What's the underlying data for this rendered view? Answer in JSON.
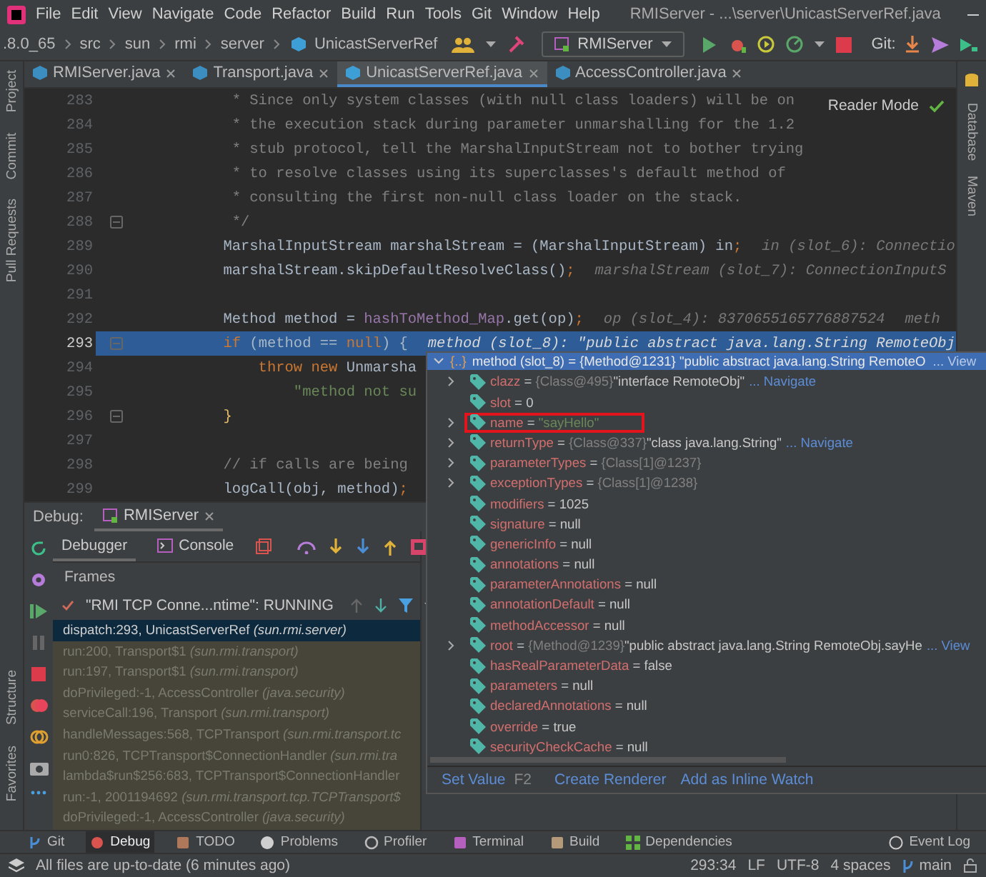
{
  "window": {
    "title": "RMIServer - ...\\server\\UnicastServerRef.java"
  },
  "menu": [
    "File",
    "Edit",
    "View",
    "Navigate",
    "Code",
    "Refactor",
    "Build",
    "Run",
    "Tools",
    "Git",
    "Window",
    "Help"
  ],
  "breadcrumbs": [
    ".8.0_65",
    "src",
    "sun",
    "rmi",
    "server",
    "UnicastServerRef"
  ],
  "run_config": "RMIServer",
  "git_label": "Git:",
  "tabs": [
    {
      "label": "RMIServer.java",
      "selected": false
    },
    {
      "label": "Transport.java",
      "selected": false
    },
    {
      "label": "UnicastServerRef.java",
      "selected": true
    },
    {
      "label": "AccessController.java",
      "selected": false
    }
  ],
  "left_tools_top": [
    "Project",
    "Commit",
    "Pull Requests"
  ],
  "left_tools_bottom": [
    "Structure",
    "Favorites"
  ],
  "right_tools": [
    "Database",
    "Maven"
  ],
  "editor": {
    "reader_mode": "Reader Mode",
    "lines": [
      {
        "number": "283",
        "current": false,
        "fold": false,
        "tokens": [
          {
            "text": "         * Since only system classes (with null class loaders) will be on",
            "kind": "comment"
          }
        ]
      },
      {
        "number": "284",
        "current": false,
        "fold": false,
        "tokens": [
          {
            "text": "         * the execution stack during parameter unmarshalling for the 1.2",
            "kind": "comment"
          }
        ]
      },
      {
        "number": "285",
        "current": false,
        "fold": false,
        "tokens": [
          {
            "text": "         * stub protocol, tell the MarshalInputStream not to bother trying",
            "kind": "comment"
          }
        ]
      },
      {
        "number": "286",
        "current": false,
        "fold": false,
        "tokens": [
          {
            "text": "         * to resolve classes using its superclasses's default method of",
            "kind": "comment"
          }
        ]
      },
      {
        "number": "287",
        "current": false,
        "fold": false,
        "tokens": [
          {
            "text": "         * consulting the first non-null class loader on the stack.",
            "kind": "comment"
          }
        ]
      },
      {
        "number": "288",
        "current": false,
        "fold": true,
        "tokens": [
          {
            "text": "         */",
            "kind": "comment"
          }
        ]
      },
      {
        "number": "289",
        "current": false,
        "fold": false,
        "tokens": [
          {
            "text": "        MarshalInputStream marshalStream = (MarshalInputStream) in",
            "kind": "plain"
          },
          {
            "text": ";",
            "kind": "keyword"
          }
        ],
        "hints": [
          "in (slot_6): Connectio"
        ]
      },
      {
        "number": "290",
        "current": false,
        "fold": false,
        "tokens": [
          {
            "text": "        marshalStream.skipDefaultResolveClass()",
            "kind": "plain"
          },
          {
            "text": ";",
            "kind": "keyword"
          }
        ],
        "hints": [
          "marshalStream (slot_7): ConnectionInputS"
        ]
      },
      {
        "number": "291",
        "current": false,
        "fold": false
      },
      {
        "number": "292",
        "current": false,
        "fold": false,
        "tokens": [
          {
            "text": "        Method method = ",
            "kind": "plain"
          },
          {
            "text": "hashToMethod_Map",
            "kind": "field"
          },
          {
            "text": ".get(op)",
            "kind": "plain"
          },
          {
            "text": ";",
            "kind": "keyword"
          }
        ],
        "hints": [
          "op (slot_4): 8370655165776887524",
          "meth"
        ]
      },
      {
        "number": "293",
        "current": true,
        "fold": true,
        "tokens": [
          {
            "text": "        if",
            "kind": "keyword"
          },
          {
            "text": " (method == ",
            "kind": "plain"
          },
          {
            "text": "null",
            "kind": "keyword"
          },
          {
            "text": ") {",
            "kind": "plain"
          }
        ],
        "hints": [
          "method (slot_8): \"public abstract java.lang.String RemoteObj"
        ]
      },
      {
        "number": "294",
        "current": false,
        "fold": false,
        "tokens": [
          {
            "text": "            throw new",
            "kind": "keyword"
          },
          {
            "text": " Unmarsha",
            "kind": "plain"
          }
        ]
      },
      {
        "number": "295",
        "current": false,
        "fold": false,
        "tokens": [
          {
            "text": "                \"method not su",
            "kind": "string"
          }
        ]
      },
      {
        "number": "296",
        "current": false,
        "fold": true,
        "tokens": [
          {
            "text": "        }",
            "kind": "brace"
          }
        ]
      },
      {
        "number": "297",
        "current": false,
        "fold": false
      },
      {
        "number": "298",
        "current": false,
        "fold": false,
        "tokens": [
          {
            "text": "        // if calls are being ",
            "kind": "comment"
          }
        ]
      },
      {
        "number": "299",
        "current": false,
        "fold": false,
        "tokens": [
          {
            "text": "        logCall(obj, method)",
            "kind": "plain"
          },
          {
            "text": ";",
            "kind": "keyword"
          }
        ]
      }
    ]
  },
  "debug": {
    "label": "Debug:",
    "session": "RMIServer",
    "tabs": [
      {
        "label": "Debugger",
        "selected": true
      },
      {
        "label": "Console",
        "selected": false
      }
    ],
    "frames_label": "Frames",
    "thread": "\"RMI TCP Conne...ntime\": RUNNING",
    "frames": [
      {
        "location": "dispatch:293, UnicastServerRef",
        "package": "(sun.rmi.server)",
        "selected": true
      },
      {
        "location": "run:200, Transport$1",
        "package": "(sun.rmi.transport)",
        "selected": false
      },
      {
        "location": "run:197, Transport$1",
        "package": "(sun.rmi.transport)",
        "selected": false
      },
      {
        "location": "doPrivileged:-1, AccessController",
        "package": "(java.security)",
        "selected": false
      },
      {
        "location": "serviceCall:196, Transport",
        "package": "(sun.rmi.transport)",
        "selected": false
      },
      {
        "location": "handleMessages:568, TCPTransport",
        "package": "(sun.rmi.transport.tc",
        "selected": false
      },
      {
        "location": "run0:826, TCPTransport$ConnectionHandler",
        "package": "(sun.rmi.tra",
        "selected": false
      },
      {
        "location": "lambda$run$256:683, TCPTransport$ConnectionHandler",
        "selected": false
      },
      {
        "location": "run:-1, 2001194692",
        "package": "(sun.rmi.transport.tcp.TCPTransport$",
        "selected": false
      },
      {
        "location": "doPrivileged:-1, AccessController",
        "package": "(java.security)",
        "selected": false
      }
    ]
  },
  "popup": {
    "object_marker": "{..}",
    "separator": "=",
    "header": {
      "name": "method (slot_8)",
      "ref": "{Method@1231}",
      "value": "\"public abstract java.lang.String RemoteO",
      "link": "... View"
    },
    "fields": [
      {
        "name": "clazz",
        "ref": "{Class@495}",
        "value": "\"interface RemoteObj\"",
        "kind": "plain",
        "expandable": true,
        "link": "... Navigate",
        "highlighted": false
      },
      {
        "name": "slot",
        "value": "0",
        "kind": "plain",
        "expandable": false,
        "highlighted": false
      },
      {
        "name": "name",
        "value": "\"sayHello\"",
        "kind": "string",
        "expandable": true,
        "highlighted": true
      },
      {
        "name": "returnType",
        "ref": "{Class@337}",
        "value": "\"class java.lang.String\"",
        "kind": "plain",
        "expandable": true,
        "link": "... Navigate",
        "highlighted": false
      },
      {
        "name": "parameterTypes",
        "ref": "{Class[1]@1237}",
        "expandable": true,
        "highlighted": false
      },
      {
        "name": "exceptionTypes",
        "ref": "{Class[1]@1238}",
        "expandable": true,
        "highlighted": false
      },
      {
        "name": "modifiers",
        "value": "1025",
        "kind": "plain",
        "expandable": false,
        "highlighted": false
      },
      {
        "name": "signature",
        "value": "null",
        "kind": "plain",
        "expandable": false,
        "highlighted": false
      },
      {
        "name": "genericInfo",
        "value": "null",
        "kind": "plain",
        "expandable": false,
        "highlighted": false
      },
      {
        "name": "annotations",
        "value": "null",
        "kind": "plain",
        "expandable": false,
        "highlighted": false
      },
      {
        "name": "parameterAnnotations",
        "value": "null",
        "kind": "plain",
        "expandable": false,
        "highlighted": false
      },
      {
        "name": "annotationDefault",
        "value": "null",
        "kind": "plain",
        "expandable": false,
        "highlighted": false
      },
      {
        "name": "methodAccessor",
        "value": "null",
        "kind": "plain",
        "expandable": false,
        "highlighted": false
      },
      {
        "name": "root",
        "ref": "{Method@1239}",
        "value": "\"public abstract java.lang.String RemoteObj.sayHe",
        "kind": "plain",
        "expandable": true,
        "link": "... View",
        "highlighted": false
      },
      {
        "name": "hasRealParameterData",
        "value": "false",
        "kind": "plain",
        "expandable": false,
        "highlighted": false
      },
      {
        "name": "parameters",
        "value": "null",
        "kind": "plain",
        "expandable": false,
        "highlighted": false
      },
      {
        "name": "declaredAnnotations",
        "value": "null",
        "kind": "plain",
        "expandable": false,
        "highlighted": false
      },
      {
        "name": "override",
        "value": "true",
        "kind": "plain",
        "expandable": false,
        "highlighted": false
      },
      {
        "name": "securityCheckCache",
        "value": "null",
        "kind": "plain",
        "expandable": false,
        "highlighted": false
      }
    ],
    "actions": [
      {
        "label": "Set Value",
        "shortcut": "F2"
      },
      {
        "label": "Create Renderer"
      },
      {
        "label": "Add as Inline Watch"
      }
    ]
  },
  "tool_windows": [
    {
      "label": "Git",
      "kind": "branch",
      "selected": false
    },
    {
      "label": "Debug",
      "kind": "bug",
      "selected": true
    },
    {
      "label": "TODO",
      "kind": "list",
      "selected": false
    },
    {
      "label": "Problems",
      "kind": "info",
      "selected": false
    },
    {
      "label": "Profiler",
      "kind": "gauge",
      "selected": false
    },
    {
      "label": "Terminal",
      "kind": "terminal",
      "selected": false
    },
    {
      "label": "Build",
      "kind": "box",
      "selected": false
    },
    {
      "label": "Dependencies",
      "kind": "grid",
      "selected": false
    }
  ],
  "event_log": "Event Log",
  "status_bar": {
    "message": "All files are up-to-date (6 minutes ago)",
    "position": "293:34",
    "line_separator": "LF",
    "encoding": "UTF-8",
    "indent": "4 spaces",
    "branch": "main"
  }
}
